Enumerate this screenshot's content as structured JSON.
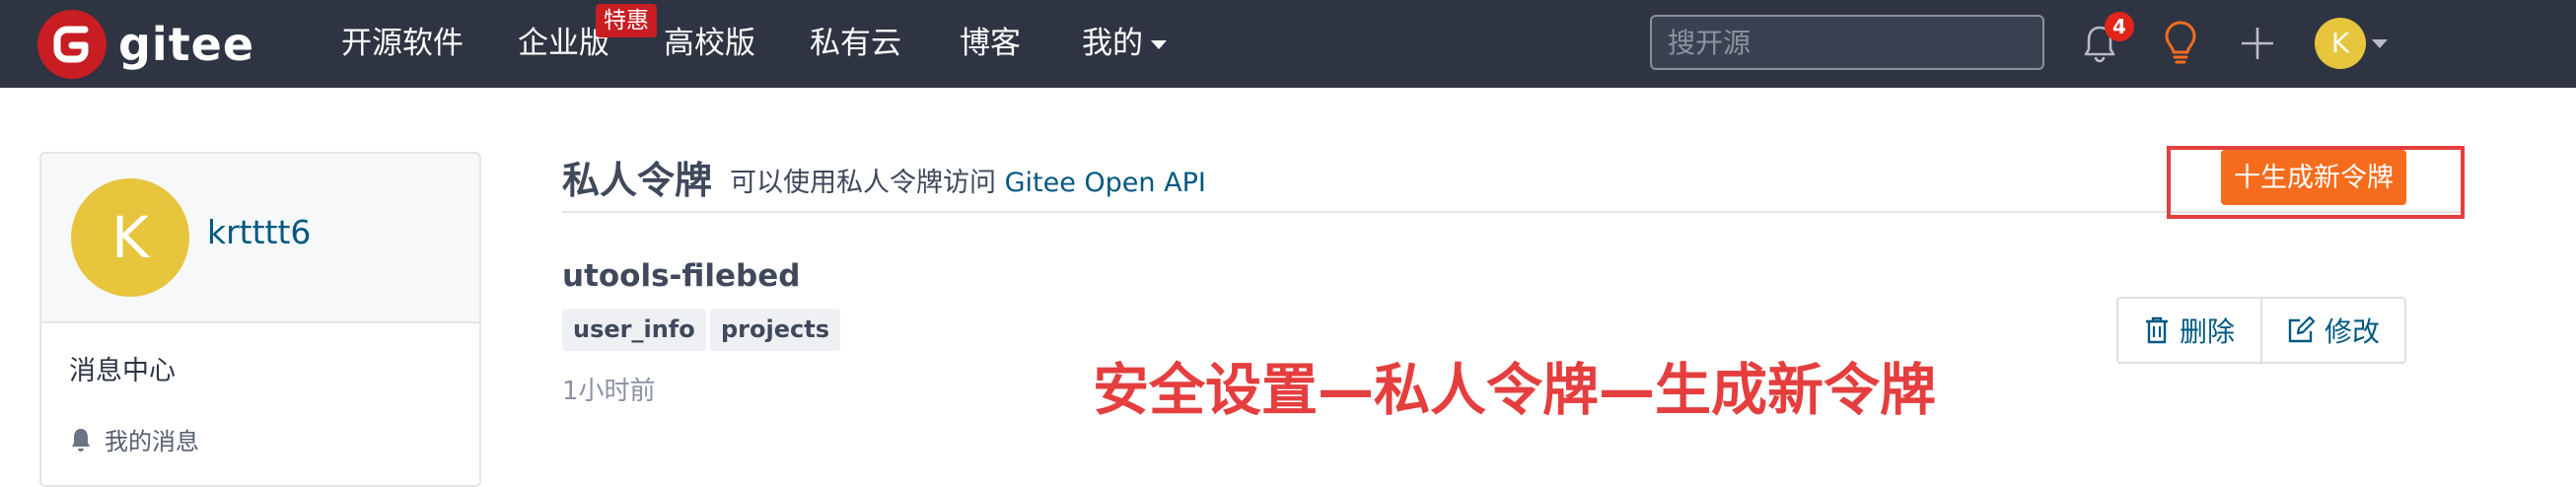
{
  "brand": {
    "name": "gitee"
  },
  "nav": {
    "items": [
      "开源软件",
      "企业版",
      "高校版",
      "私有云",
      "博客",
      "我的"
    ],
    "hot_badge": "特惠"
  },
  "search": {
    "placeholder": "搜开源"
  },
  "notifications": {
    "count": "4"
  },
  "user": {
    "initial": "K",
    "name": "krtttt6"
  },
  "sidebar": {
    "section_title": "消息中心",
    "item_label": "我的消息"
  },
  "page": {
    "title": "私人令牌",
    "description": "可以使用私人令牌访问",
    "link_text": "Gitee Open API",
    "new_token_label": "十生成新令牌"
  },
  "token": {
    "name": "utools-filebed",
    "scopes": [
      "user_info",
      "projects"
    ],
    "created": "1小时前",
    "delete_label": "删除",
    "edit_label": "修改"
  },
  "annotation": {
    "text": "安全设置—私人令牌—生成新令牌"
  },
  "colors": {
    "nav_bg": "#2e3442",
    "brand_red": "#c71d23",
    "accent_orange": "#f56c1d",
    "link_blue": "#005980",
    "annotation_red": "#e53e3e",
    "avatar_yellow": "#e7c53c"
  },
  "icons": {
    "notification": "bell-icon",
    "tips": "lightbulb-icon",
    "add": "plus-icon",
    "message": "bell-icon",
    "delete": "trash-icon",
    "edit": "edit-icon"
  }
}
